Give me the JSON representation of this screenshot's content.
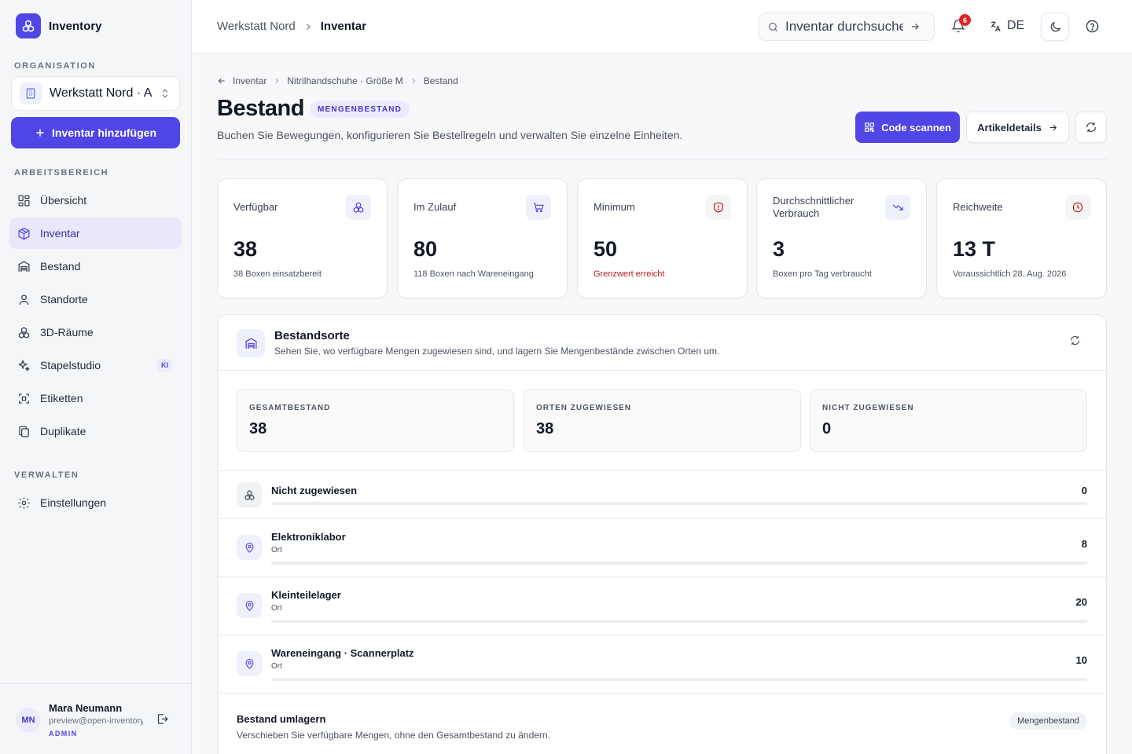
{
  "app": {
    "name": "Inventory"
  },
  "sidebar": {
    "org_label": "ORGANISATION",
    "org_name": "Werkstatt Nord · A",
    "add_button": "Inventar hinzufügen",
    "workspace_label": "ARBEITSBEREICH",
    "workspace_items": [
      {
        "label": "Übersicht",
        "icon": "grid-icon"
      },
      {
        "label": "Inventar",
        "icon": "box-icon",
        "active": true
      },
      {
        "label": "Bestand",
        "icon": "warehouse-icon"
      },
      {
        "label": "Standorte",
        "icon": "map-pin-icon"
      },
      {
        "label": "3D-Räume",
        "icon": "boxes-icon"
      },
      {
        "label": "Stapelstudio",
        "icon": "sparkles-icon",
        "badge": "KI"
      },
      {
        "label": "Etiketten",
        "icon": "scan-icon"
      },
      {
        "label": "Duplikate",
        "icon": "copy-icon"
      }
    ],
    "manage_label": "VERWALTEN",
    "manage_items": [
      {
        "label": "Einstellungen",
        "icon": "gear-icon"
      }
    ],
    "user": {
      "initials": "MN",
      "name": "Mara Neumann",
      "email": "preview@open-inventory",
      "role": "ADMIN"
    }
  },
  "topbar": {
    "breadcrumb": [
      "Werkstatt Nord",
      "Inventar"
    ],
    "search_placeholder": "Inventar durchsuchen",
    "notifications_count": "6",
    "language": "DE"
  },
  "page": {
    "breadcrumb": [
      "Inventar",
      "Nitrilhandschuhe · Größe M",
      "Bestand"
    ],
    "title": "Bestand",
    "badge": "MENGENBESTAND",
    "subtitle": "Buchen Sie Bewegungen, konfigurieren Sie Bestellregeln und verwalten Sie einzelne Einheiten.",
    "scan_button": "Code scannen",
    "details_button": "Artikeldetails"
  },
  "stats": [
    {
      "label": "Verfügbar",
      "value": "38",
      "sub": "38 Boxen einsatzbereit",
      "icon": "boxes-icon",
      "tone": "indigo"
    },
    {
      "label": "Im Zulauf",
      "value": "80",
      "sub": "118 Boxen nach Wareneingang",
      "icon": "cart-icon",
      "tone": "indigo"
    },
    {
      "label": "Minimum",
      "value": "50",
      "sub": "Grenzwert erreicht",
      "icon": "shield-alert-icon",
      "tone": "red",
      "warn": true
    },
    {
      "label": "Durchschnittlicher Verbrauch",
      "value": "3",
      "sub": "Boxen pro Tag verbraucht",
      "icon": "trending-down-icon",
      "tone": "indigo"
    },
    {
      "label": "Reichweite",
      "value": "13 T",
      "sub": "Voraussichtlich 28. Aug. 2026",
      "icon": "clock-icon",
      "tone": "red"
    }
  ],
  "locations_panel": {
    "title": "Bestandsorte",
    "subtitle": "Sehen Sie, wo verfügbare Mengen zugewiesen sind, und lagern Sie Mengenbestände zwischen Orten um.",
    "summary": [
      {
        "label": "GESAMTBESTAND",
        "value": "38"
      },
      {
        "label": "ORTEN ZUGEWIESEN",
        "value": "38"
      },
      {
        "label": "NICHT ZUGEWIESEN",
        "value": "0"
      }
    ],
    "rows": [
      {
        "name": "Nicht zugewiesen",
        "type": "",
        "qty": "0",
        "share": 0,
        "icon": "boxes-icon"
      },
      {
        "name": "Elektroniklabor",
        "type": "Ort",
        "qty": "8",
        "share": 0,
        "icon": "map-pin-icon"
      },
      {
        "name": "Kleinteilelager",
        "type": "Ort",
        "qty": "20",
        "share": 0,
        "icon": "map-pin-icon"
      },
      {
        "name": "Wareneingang · Scannerplatz",
        "type": "Ort",
        "qty": "10",
        "share": 0,
        "icon": "map-pin-icon"
      }
    ],
    "move_title": "Bestand umlagern",
    "move_subtitle": "Verschieben Sie verfügbare Mengen, ohne den Gesamtbestand zu ändern.",
    "move_badge": "Mengenbestand"
  },
  "colors": {
    "accent": "#4f46e5",
    "danger": "#b91c1c",
    "border": "#e5e7eb"
  }
}
